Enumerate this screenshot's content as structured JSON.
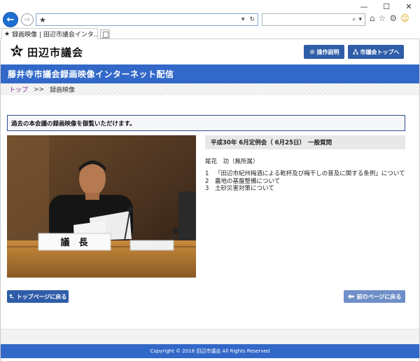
{
  "browser": {
    "tab_title": "録画映像 | 田辺市議会インタ...",
    "window_controls": {
      "minimize": "—",
      "maximize": "☐",
      "close": "✕"
    },
    "back_glyph": "←",
    "forward_glyph": "⇨",
    "address_star": "★",
    "address_tools": {
      "dropdown": "▾",
      "refresh": "↻"
    },
    "search_tools": {
      "search": "⌕",
      "dropdown": "▾"
    },
    "toolbar_icons": {
      "home": "⌂",
      "favorites": "☆",
      "settings": "⚙",
      "feedback": "☺"
    },
    "tab_close": "×"
  },
  "header": {
    "site_title": "田辺市議会",
    "help_button": "操作説明",
    "top_button": "市議会トップへ"
  },
  "banner": {
    "title": "藤井寺市議会録画映像インターネット配信"
  },
  "breadcrumb": {
    "home": "トップ",
    "separator": ">>",
    "current": "録画映像"
  },
  "notice": {
    "text": "過去の本会議の録画映像を御覧いただけます。"
  },
  "video": {
    "nameplate": "議　長"
  },
  "meeting": {
    "header": "平成30年 6月定例会（ 6月25日）　一般質問",
    "speaker": "尾花　功（無所属）",
    "topics": [
      {
        "num": "1",
        "text": "「田辺市紀州梅酒による乾杯及び梅干しの普及に関する条例」について"
      },
      {
        "num": "2",
        "text": "農地の基盤整備について"
      },
      {
        "num": "3",
        "text": "土砂災害対策について"
      }
    ]
  },
  "buttons": {
    "back_to_top": "トップページに戻る",
    "prev_page": "前のページに戻る"
  },
  "footer": {
    "copyright": "Copyright © 2018 田辺市議会 All Rights Reserved"
  },
  "colors": {
    "brand_blue": "#3268c8",
    "button_blue": "#2f5da8",
    "link_purple": "#8a2c8c"
  }
}
